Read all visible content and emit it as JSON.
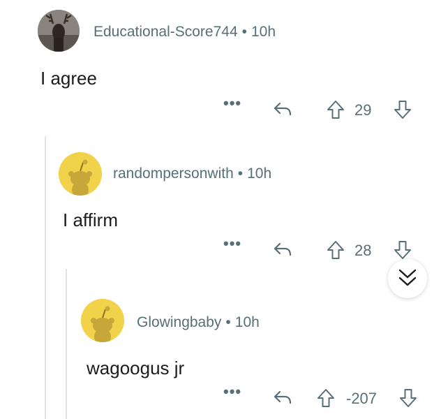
{
  "comments": [
    {
      "username": "Educational-Score744",
      "separator": "•",
      "time": "10h",
      "body": "I agree",
      "score": "29",
      "more": "•••"
    },
    {
      "username": "randompersonwith",
      "separator": "•",
      "time": "10h",
      "body": "I affirm",
      "score": "28",
      "more": "•••"
    },
    {
      "username": "Glowingbaby",
      "separator": "•",
      "time": "10h",
      "body": "wagoogus jr",
      "score": "-207",
      "more": "•••"
    }
  ],
  "icons": {
    "reply": "reply-icon",
    "upvote": "upvote-arrow-icon",
    "downvote": "downvote-arrow-icon",
    "collapse": "double-chevron-down-icon"
  },
  "colors": {
    "meta_text": "#576f76",
    "thread_line": "#e4e4e4",
    "snoo_avatar_bg": "#f2d24a"
  }
}
